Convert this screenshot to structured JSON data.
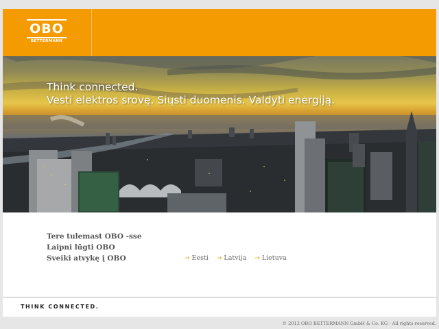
{
  "header": {
    "logo_text": "OBO",
    "logo_subtext": "BETTERMANN",
    "brand_color": "#f39b00"
  },
  "banner": {
    "tagline_line1": "Think connected.",
    "tagline_line2": "Vesti elektros srovę. Siųsti duomenis. Valdyti energiją."
  },
  "welcome": {
    "lines": [
      "Tere tulemast OBO -sse",
      "Laipni lūgti OBO",
      "Sveiki atvykę į OBO"
    ]
  },
  "languages": {
    "arrow_icon": "arrow-right-icon",
    "items": [
      {
        "label": "Eesti"
      },
      {
        "label": "Latvija"
      },
      {
        "label": "Lietuva"
      }
    ]
  },
  "footer": {
    "slogan": "THINK CONNECTED.",
    "copyright": "© 2012 OBO BETTERMANN GmbH & Co. KG - All rights reserved."
  }
}
